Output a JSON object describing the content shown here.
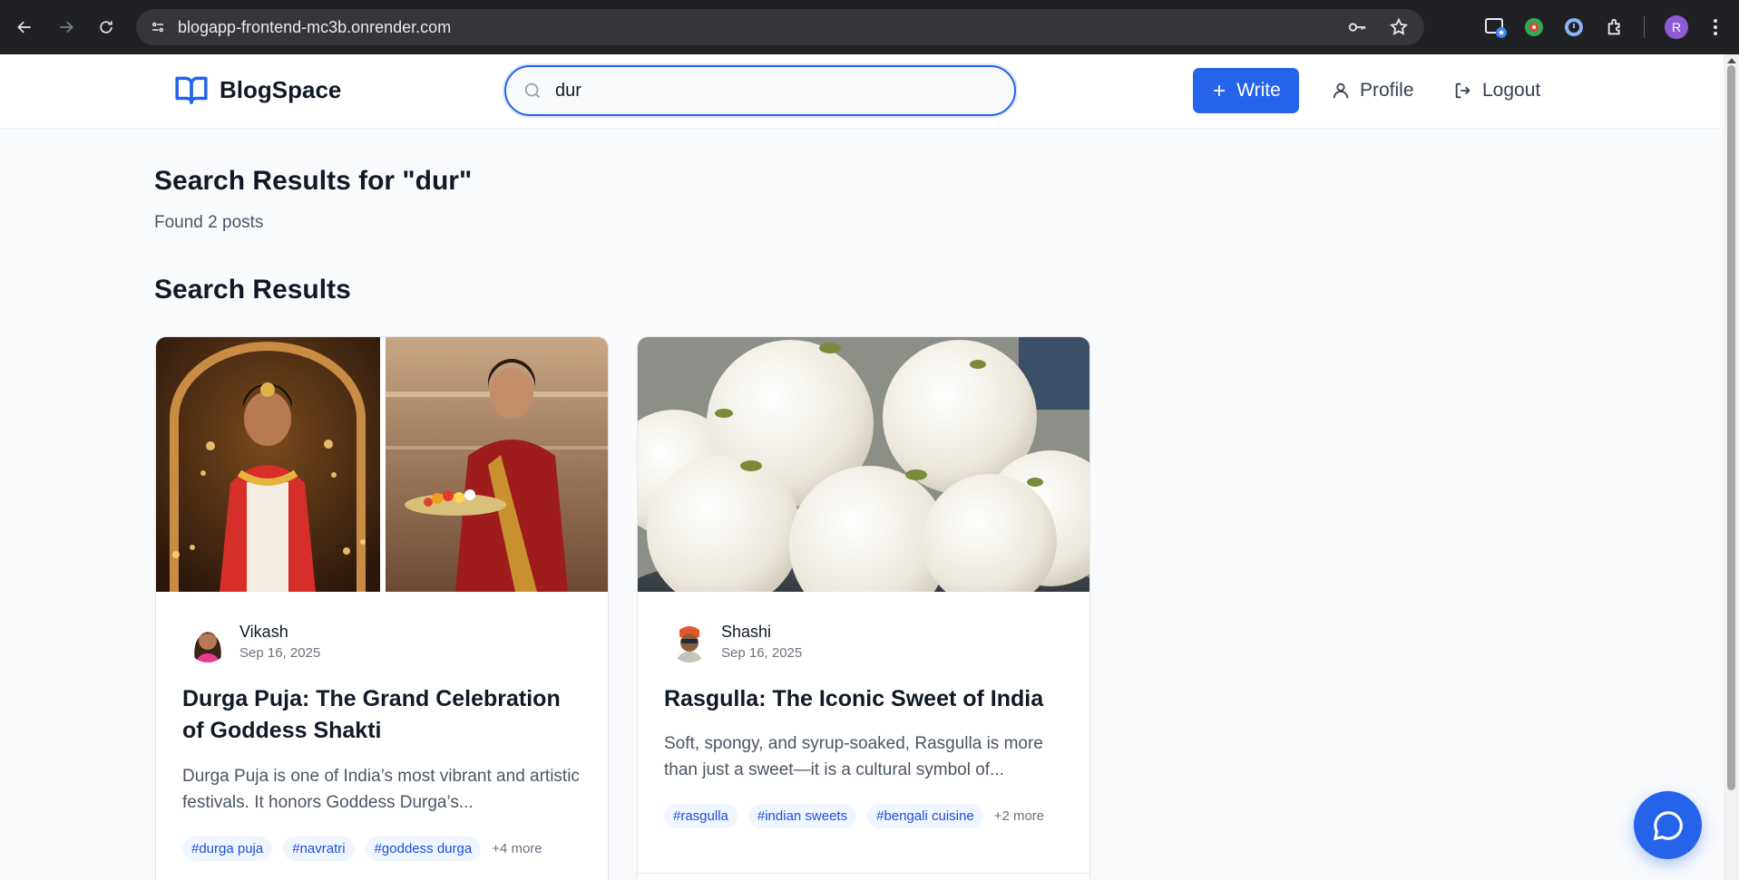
{
  "browser": {
    "url": "blogapp-frontend-mc3b.onrender.com",
    "profile_initial": "R"
  },
  "header": {
    "brand": "BlogSpace",
    "search_value": "dur",
    "write_label": "Write",
    "profile_label": "Profile",
    "logout_label": "Logout"
  },
  "results": {
    "heading": "Search Results for \"dur\"",
    "count_text": "Found 2 posts",
    "section_heading": "Search Results"
  },
  "posts": [
    {
      "author": "Vikash",
      "date": "Sep 16, 2025",
      "title": "Durga Puja: The Grand Celebration of Goddess Shakti",
      "excerpt": "Durga Puja is one of India’s most vibrant and artistic festivals. It honors Goddess Durga’s...",
      "tags": [
        "#durga puja",
        "#navratri",
        "#goddess durga"
      ],
      "more": "+4 more"
    },
    {
      "author": "Shashi",
      "date": "Sep 16, 2025",
      "title": "Rasgulla: The Iconic Sweet of India",
      "excerpt": "Soft, spongy, and syrup-soaked, Rasgulla is more than just a sweet—it is a cultural symbol of...",
      "tags": [
        "#rasgulla",
        "#indian sweets",
        "#bengali cuisine"
      ],
      "more": "+2 more"
    }
  ],
  "colors": {
    "accent": "#2563eb",
    "background": "#f8fafc",
    "tag_bg": "#eff6ff",
    "tag_text": "#1d4ed8"
  }
}
